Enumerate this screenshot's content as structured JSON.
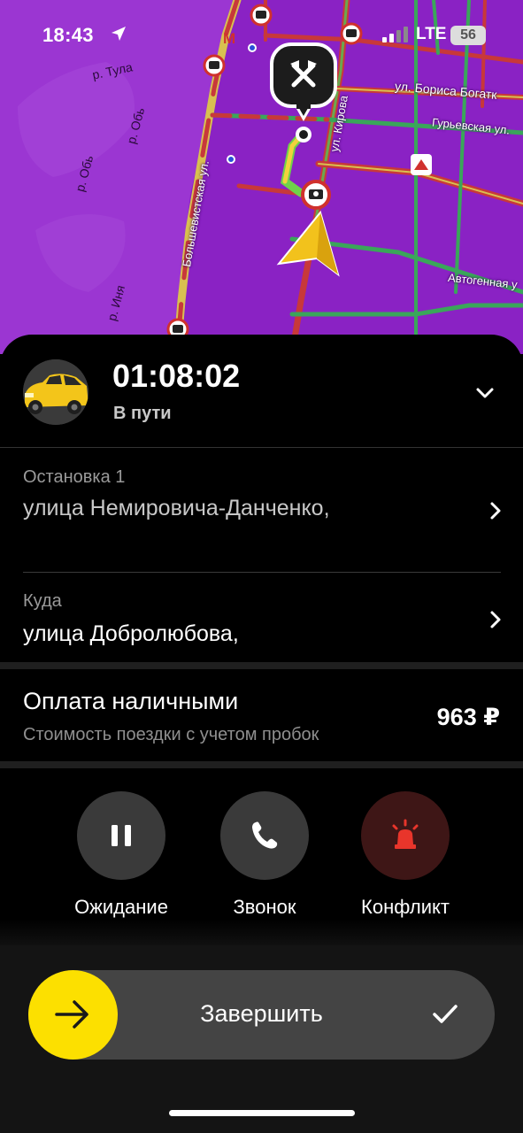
{
  "status_bar": {
    "time": "18:43",
    "network": "LTE",
    "battery": "56"
  },
  "map": {
    "labels": {
      "river_tula": "р. Тула",
      "river_ob_1": "р. Обь",
      "river_ob_2": "р. Обь",
      "river_inya": "р. Иня",
      "street_bolshevistskaya": "Большевистская ул.",
      "street_kirova": "ул. Кирова",
      "street_bogatkova": "ул. Бориса Богатк",
      "street_guryevskaya": "Гурьевская ул.",
      "street_avtogennaya": "Автогенная у"
    },
    "metro_letter": "М"
  },
  "trip": {
    "timer": "01:08:02",
    "status": "В пути"
  },
  "stops": [
    {
      "label": "Остановка 1",
      "address": "улица Немировича-Данченко,"
    },
    {
      "label": "Куда",
      "address": "улица Добролюбова,"
    }
  ],
  "payment": {
    "title": "Оплата наличными",
    "subtitle": "Стоимость поездки с учетом пробок",
    "price": "963 ₽"
  },
  "actions": [
    {
      "label": "Ожидание",
      "icon": "pause-icon"
    },
    {
      "label": "Звонок",
      "icon": "phone-icon"
    },
    {
      "label": "Конфликт",
      "icon": "siren-icon"
    }
  ],
  "finish": {
    "label": "Завершить"
  },
  "colors": {
    "map_bg": "#8a22c4",
    "accent_yellow": "#fce000",
    "sheet_bg": "#000000",
    "conflict_red": "#e8352b"
  }
}
